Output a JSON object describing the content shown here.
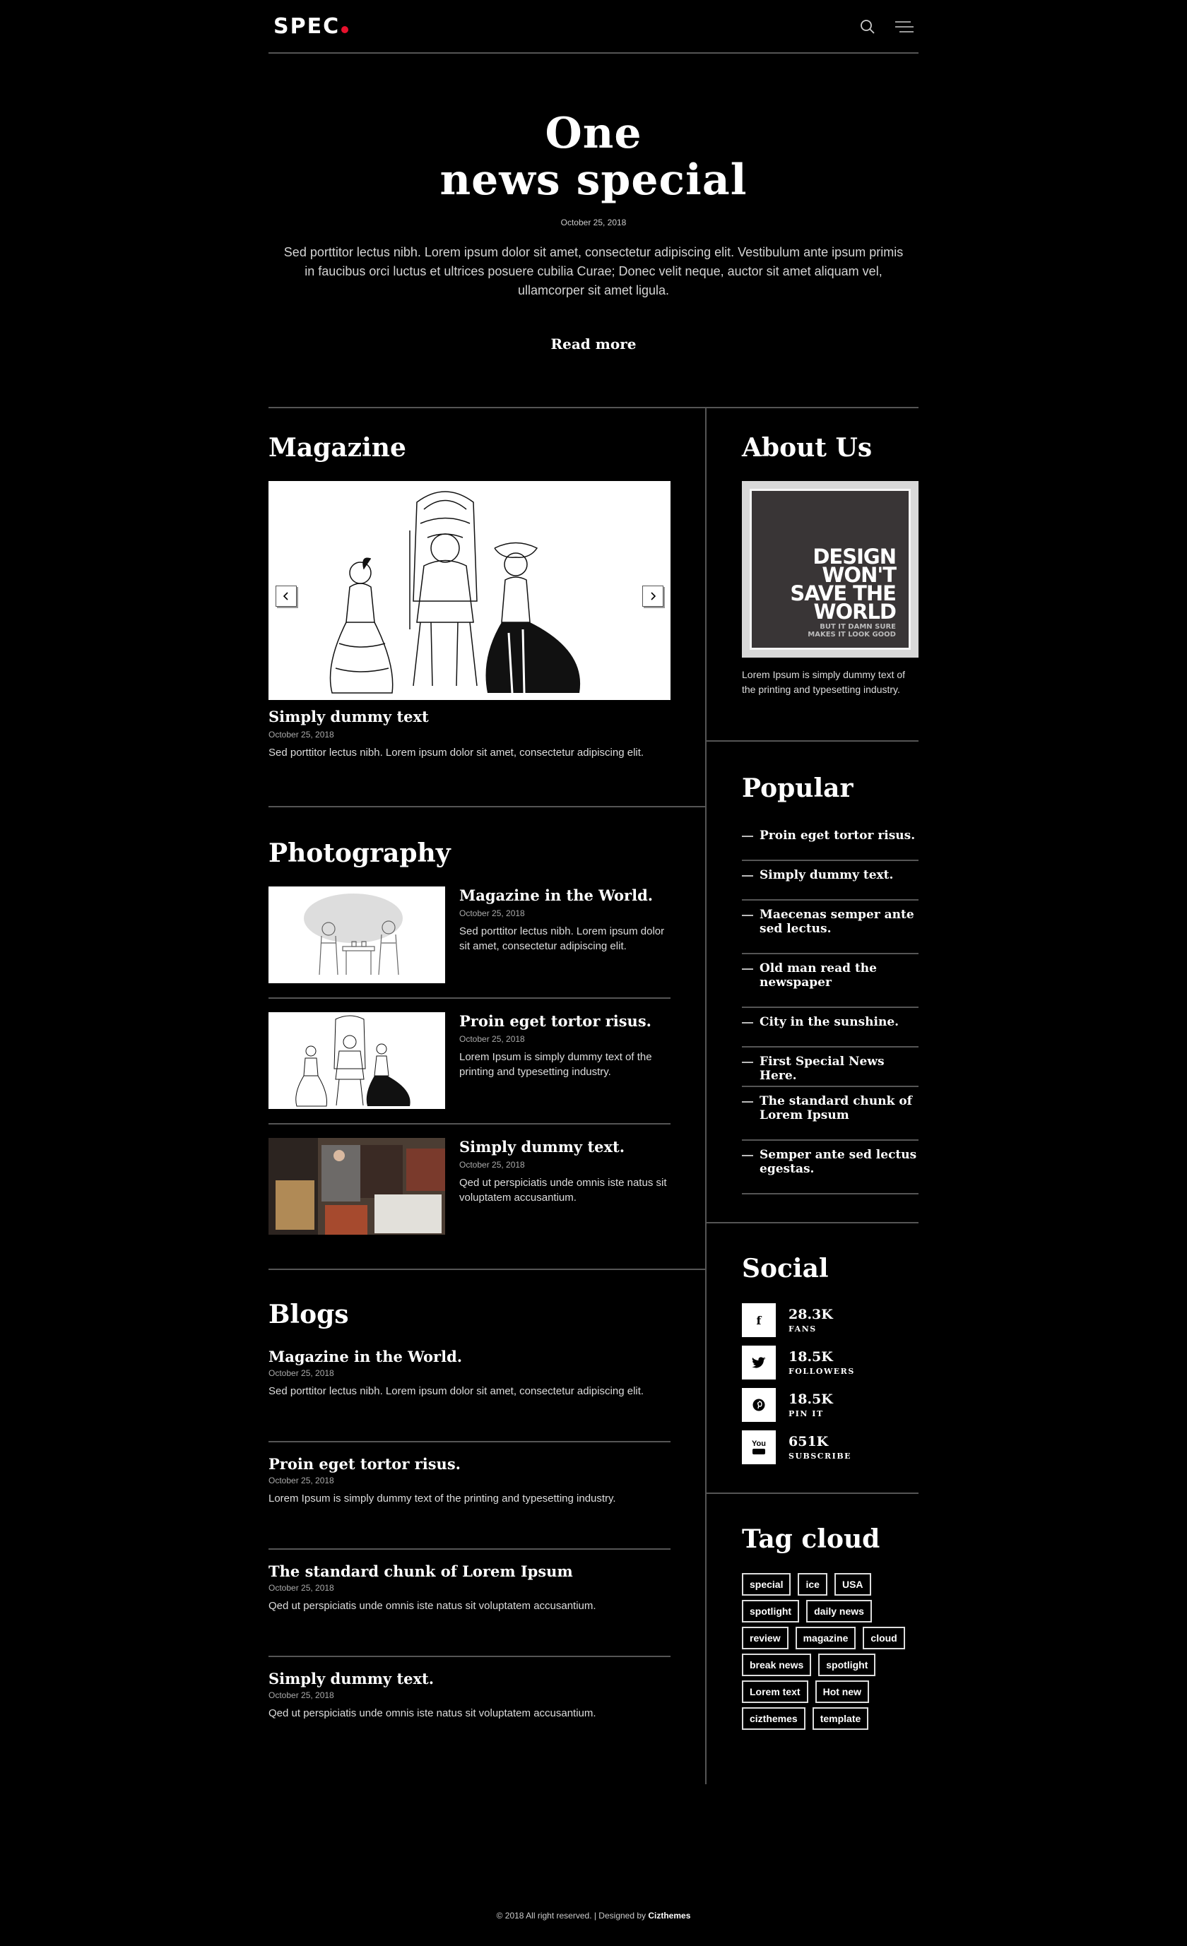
{
  "header": {
    "logo": "SPEC",
    "accent": "#e8112d"
  },
  "hero": {
    "title_line1": "One",
    "title_line2": "news special",
    "date": "October 25, 2018",
    "text": "Sed porttitor lectus nibh. Lorem ipsum dolor sit amet, consectetur adipiscing elit. Vestibulum ante ipsum primis in faucibus orci luctus et ultrices posuere cubilia Curae; Donec velit neque, auctor sit amet aliquam vel, ullamcorper sit amet ligula.",
    "read_more": "Read more"
  },
  "magazine": {
    "title": "Magazine",
    "item": {
      "title": "Simply dummy text",
      "date": "October 25, 2018",
      "text": "Sed porttitor lectus nibh. Lorem ipsum dolor sit amet, consectetur adipiscing elit."
    }
  },
  "photography": {
    "title": "Photography",
    "items": [
      {
        "title": "Magazine in the World.",
        "date": "October 25, 2018",
        "text": "Sed porttitor lectus nibh. Lorem ipsum dolor sit amet, consectetur adipiscing elit."
      },
      {
        "title": "Proin eget tortor risus.",
        "date": "October 25, 2018",
        "text": "Lorem Ipsum is simply dummy text of the printing and typesetting industry."
      },
      {
        "title": "Simply dummy text.",
        "date": "October 25, 2018",
        "text": "Qed ut perspiciatis unde omnis iste natus sit voluptatem accusantium."
      }
    ]
  },
  "blogs": {
    "title": "Blogs",
    "items": [
      {
        "title": "Magazine in the World.",
        "date": "October 25, 2018",
        "text": "Sed porttitor lectus nibh. Lorem ipsum dolor sit amet, consectetur adipiscing elit."
      },
      {
        "title": "Proin eget tortor risus.",
        "date": "October 25, 2018",
        "text": "Lorem Ipsum is simply dummy text of the printing and typesetting industry."
      },
      {
        "title": "The standard chunk of Lorem Ipsum",
        "date": "October 25, 2018",
        "text": "Qed ut perspiciatis unde omnis iste natus sit voluptatem accusantium."
      },
      {
        "title": "Simply dummy text.",
        "date": "October 25, 2018",
        "text": "Qed ut perspiciatis unde omnis iste natus sit voluptatem accusantium."
      }
    ]
  },
  "about": {
    "title": "About Us",
    "poster": {
      "l1": "DESIGN",
      "l2": "WON'T",
      "l3": "SAVE THE",
      "l4": "WORLD",
      "l5": "BUT IT DAMN SURE",
      "l6": "MAKES IT LOOK GOOD"
    },
    "text": "Lorem Ipsum is simply dummy text of the printing and typesetting industry."
  },
  "popular": {
    "title": "Popular",
    "items": [
      "Proin eget tortor risus.",
      "Simply dummy text.",
      "Maecenas semper ante sed lectus.",
      "Old man read the newspaper",
      "City in the sunshine.",
      "First Special News Here.",
      "The standard chunk of Lorem Ipsum",
      "Semper ante sed lectus egestas."
    ]
  },
  "social": {
    "title": "Social",
    "items": [
      {
        "icon": "facebook-icon",
        "glyph": "f",
        "count": "28.3K",
        "label": "FANS"
      },
      {
        "icon": "twitter-icon",
        "glyph": "t",
        "count": "18.5K",
        "label": "FOLLOWERS"
      },
      {
        "icon": "pinterest-icon",
        "glyph": "p",
        "count": "18.5K",
        "label": "PIN IT"
      },
      {
        "icon": "youtube-icon",
        "glyph": "You",
        "count": "651K",
        "label": "SUBSCRIBE"
      }
    ]
  },
  "tagcloud": {
    "title": "Tag cloud",
    "tags": [
      "special",
      "ice",
      "USA",
      "spotlight",
      "daily news",
      "review",
      "magazine",
      "cloud",
      "break news",
      "spotlight",
      "Lorem text",
      "Hot new",
      "cizthemes",
      "template"
    ]
  },
  "footer": {
    "text": "© 2018 All right reserved.  |  Designed by ",
    "brand": "Cizthemes"
  }
}
